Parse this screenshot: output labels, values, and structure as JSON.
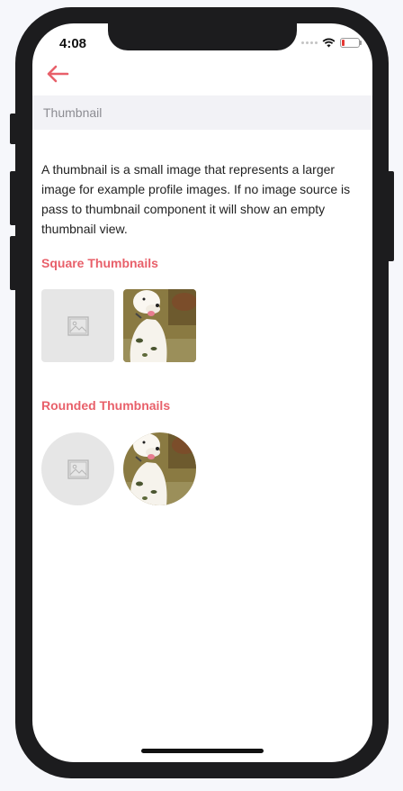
{
  "status_bar": {
    "time": "4:08"
  },
  "nav": {
    "back_icon": "arrow-left-icon",
    "accent": "#e8606a"
  },
  "header": {
    "title": "Thumbnail"
  },
  "description": "A thumbnail is a small image that represents a larger image for example profile images. If no image source is pass to thumbnail component it will show an empty thumbnail view.",
  "sections": [
    {
      "title": "Square Thumbnails",
      "thumbnails": [
        {
          "kind": "empty",
          "icon": "image-placeholder-icon"
        },
        {
          "kind": "photo",
          "subject": "white dog"
        }
      ]
    },
    {
      "title": "Rounded Thumbnails",
      "thumbnails": [
        {
          "kind": "empty",
          "icon": "image-placeholder-icon"
        },
        {
          "kind": "photo",
          "subject": "white dog"
        }
      ]
    }
  ],
  "colors": {
    "accent": "#e8606a",
    "header_bg": "#f2f2f6",
    "placeholder_bg": "#e6e6e6"
  }
}
